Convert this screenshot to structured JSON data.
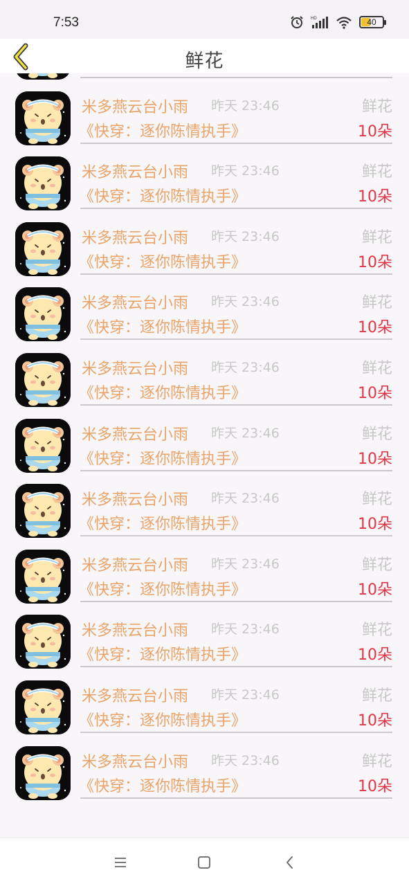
{
  "status_bar": {
    "time": "7:53",
    "battery": "40",
    "icons": [
      "alarm-icon",
      "hd-signal-icon",
      "wifi-icon",
      "battery-icon"
    ]
  },
  "header": {
    "title": "鲜花",
    "back_icon": "chevron-left-icon"
  },
  "gift_list": [
    {
      "name": "米多燕云台小雨",
      "time": "昨天 23:46",
      "gift_type": "鲜花",
      "book_title": "《快穿：逐你陈情执手》",
      "count": "10朵"
    },
    {
      "name": "米多燕云台小雨",
      "time": "昨天 23:46",
      "gift_type": "鲜花",
      "book_title": "《快穿：逐你陈情执手》",
      "count": "10朵"
    },
    {
      "name": "米多燕云台小雨",
      "time": "昨天 23:46",
      "gift_type": "鲜花",
      "book_title": "《快穿：逐你陈情执手》",
      "count": "10朵"
    },
    {
      "name": "米多燕云台小雨",
      "time": "昨天 23:46",
      "gift_type": "鲜花",
      "book_title": "《快穿：逐你陈情执手》",
      "count": "10朵"
    },
    {
      "name": "米多燕云台小雨",
      "time": "昨天 23:46",
      "gift_type": "鲜花",
      "book_title": "《快穿：逐你陈情执手》",
      "count": "10朵"
    },
    {
      "name": "米多燕云台小雨",
      "time": "昨天 23:46",
      "gift_type": "鲜花",
      "book_title": "《快穿：逐你陈情执手》",
      "count": "10朵"
    },
    {
      "name": "米多燕云台小雨",
      "time": "昨天 23:46",
      "gift_type": "鲜花",
      "book_title": "《快穿：逐你陈情执手》",
      "count": "10朵"
    },
    {
      "name": "米多燕云台小雨",
      "time": "昨天 23:46",
      "gift_type": "鲜花",
      "book_title": "《快穿：逐你陈情执手》",
      "count": "10朵"
    },
    {
      "name": "米多燕云台小雨",
      "time": "昨天 23:46",
      "gift_type": "鲜花",
      "book_title": "《快穿：逐你陈情执手》",
      "count": "10朵"
    },
    {
      "name": "米多燕云台小雨",
      "time": "昨天 23:46",
      "gift_type": "鲜花",
      "book_title": "《快穿：逐你陈情执手》",
      "count": "10朵"
    },
    {
      "name": "米多燕云台小雨",
      "time": "昨天 23:46",
      "gift_type": "鲜花",
      "book_title": "《快穿：逐你陈情执手》",
      "count": "10朵"
    },
    {
      "name": "米多燕云台小雨",
      "time": "昨天 23:46",
      "gift_type": "鲜花",
      "book_title": "《快穿：逐你陈情执手》",
      "count": "10朵"
    }
  ],
  "nav_bar": {
    "icons": [
      "menu-icon",
      "home-square-icon",
      "back-triangle-icon"
    ]
  },
  "colors": {
    "accent_orange": "#e9a46a",
    "count_red": "#e23545",
    "muted_gray": "#c8c8c8",
    "back_arrow_yellow": "#f0e046"
  }
}
